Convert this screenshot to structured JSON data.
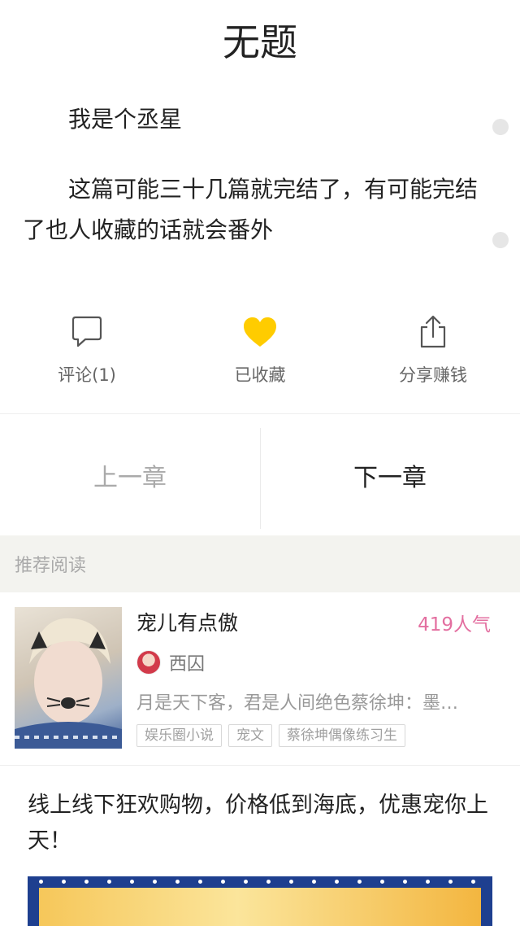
{
  "page": {
    "title": "无题",
    "paragraphs": [
      "我是个丞星",
      "这篇可能三十几篇就完结了，有可能完结了也人收藏的话就会番外"
    ]
  },
  "actions": {
    "comment_label": "评论(1)",
    "favorite_label": "已收藏",
    "share_label": "分享赚钱",
    "favorite_color": "#ffcc00"
  },
  "chapter_nav": {
    "prev_label": "上一章",
    "next_label": "下一章"
  },
  "recommend": {
    "header": "推荐阅读",
    "book": {
      "title": "宠儿有点傲",
      "popularity": "419人气",
      "author": "西囚",
      "description": "月是天下客，君是人间绝色蔡徐坤：墨…",
      "tags": [
        "娱乐圈小说",
        "宠文",
        "蔡徐坤偶像练习生"
      ]
    }
  },
  "ad": {
    "text": "线上线下狂欢购物，价格低到海底，优惠宠你上天！"
  }
}
